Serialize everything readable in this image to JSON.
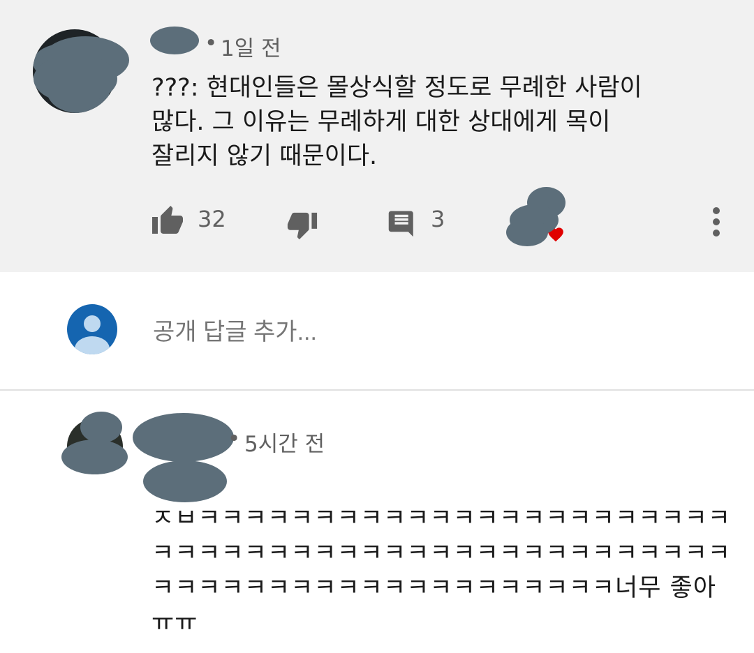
{
  "comment": {
    "time": "1일 전",
    "text": "???: 현대인들은 몰상식할 정도로 무례한 사람이\n많다. 그 이유는 무례하게 대한 상대에게 목이\n잘리지 않기 때문이다.",
    "likes": "32",
    "replies": "3",
    "icons": [
      "thumbs-up-icon",
      "thumbs-down-icon",
      "comment-icon",
      "heart-icon",
      "more-vert-icon"
    ],
    "heart_color": "#e00000"
  },
  "reply_box": {
    "placeholder": "공개 답글 추가..."
  },
  "reply": {
    "time": "5시간 전",
    "text": "ㅈㅂㅋㅋㅋㅋㅋㅋㅋㅋㅋㅋㅋㅋㅋㅋㅋㅋㅋㅋㅋㅋㅋㅋㅋㅋㅋㅋㅋㅋㅋㅋㅋㅋㅋㅋㅋㅋㅋㅋㅋㅋㅋㅋㅋㅋㅋㅋㅋㅋㅋㅋㅋㅋㅋㅋㅋㅋㅋㅋㅋㅋㅋㅋㅋㅋㅋㅋㅋㅋ너무 좋아 ㅠㅠ"
  }
}
